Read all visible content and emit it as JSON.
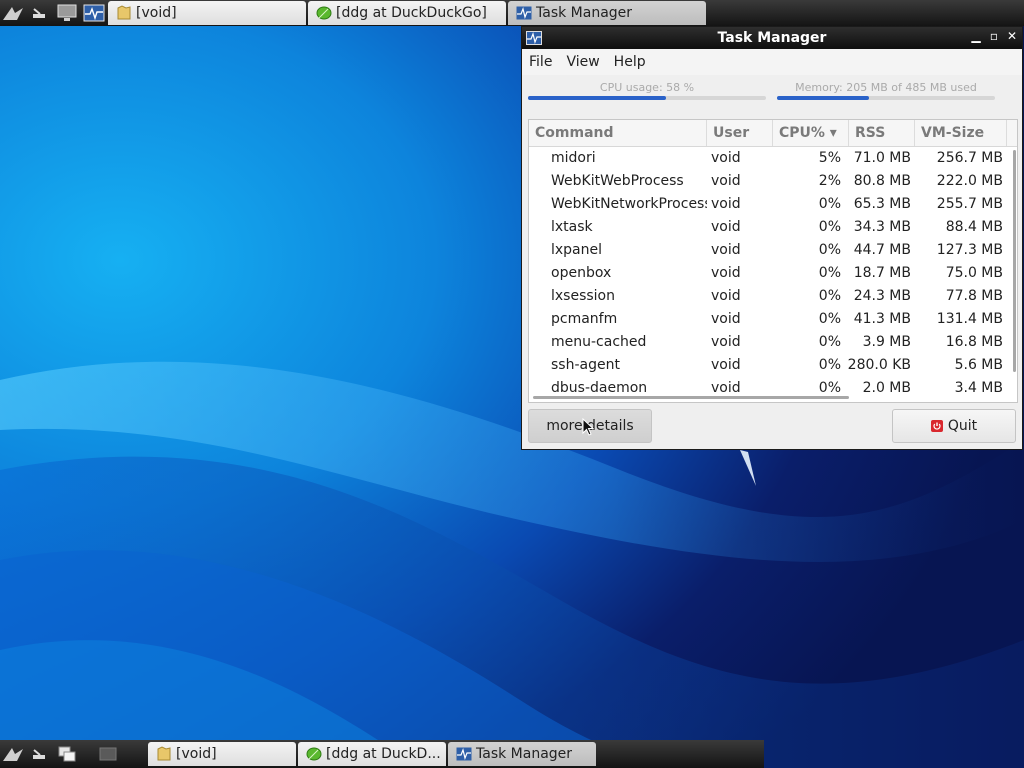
{
  "top_panel": {
    "tasks": [
      {
        "label": "[void]",
        "icon": "folder-icon"
      },
      {
        "label": "[ddg at DuckDuckGo]",
        "icon": "midori-leaf-icon"
      },
      {
        "label": "Task Manager",
        "icon": "task-manager-icon"
      }
    ]
  },
  "bottom_panel": {
    "tasks": [
      {
        "label": "[void]",
        "icon": "folder-icon"
      },
      {
        "label": "[ddg at DuckD...",
        "icon": "midori-leaf-icon"
      },
      {
        "label": "Task Manager",
        "icon": "task-manager-icon"
      }
    ]
  },
  "window": {
    "title": "Task Manager",
    "menu": [
      "File",
      "View",
      "Help"
    ],
    "cpu": {
      "label": "CPU usage: 58 %",
      "fraction": 0.58
    },
    "memory": {
      "label": "Memory: 205 MB of 485 MB used",
      "fraction": 0.4227
    },
    "columns": [
      "Command",
      "User",
      "CPU% ▾",
      "RSS",
      "VM-Size"
    ],
    "rows": [
      [
        "midori",
        "void",
        "5%",
        "71.0 MB",
        "256.7 MB"
      ],
      [
        "WebKitWebProcess",
        "void",
        "2%",
        "80.8 MB",
        "222.0 MB"
      ],
      [
        "WebKitNetworkProcess",
        "void",
        "0%",
        "65.3 MB",
        "255.7 MB"
      ],
      [
        "lxtask",
        "void",
        "0%",
        "34.3 MB",
        "88.4 MB"
      ],
      [
        "lxpanel",
        "void",
        "0%",
        "44.7 MB",
        "127.3 MB"
      ],
      [
        "openbox",
        "void",
        "0%",
        "18.7 MB",
        "75.0 MB"
      ],
      [
        "lxsession",
        "void",
        "0%",
        "24.3 MB",
        "77.8 MB"
      ],
      [
        "pcmanfm",
        "void",
        "0%",
        "41.3 MB",
        "131.4 MB"
      ],
      [
        "menu-cached",
        "void",
        "0%",
        "3.9 MB",
        "16.8 MB"
      ],
      [
        "ssh-agent",
        "void",
        "0%",
        "280.0 KB",
        "5.6 MB"
      ],
      [
        "dbus-daemon",
        "void",
        "0%",
        "2.0 MB",
        "3.4 MB"
      ]
    ],
    "more_details_label": "more details",
    "quit_label": "Quit"
  },
  "colors": {
    "accent": "#2a62c9",
    "panel": "#1e1e1e",
    "quit_icon": "#d9282e"
  }
}
